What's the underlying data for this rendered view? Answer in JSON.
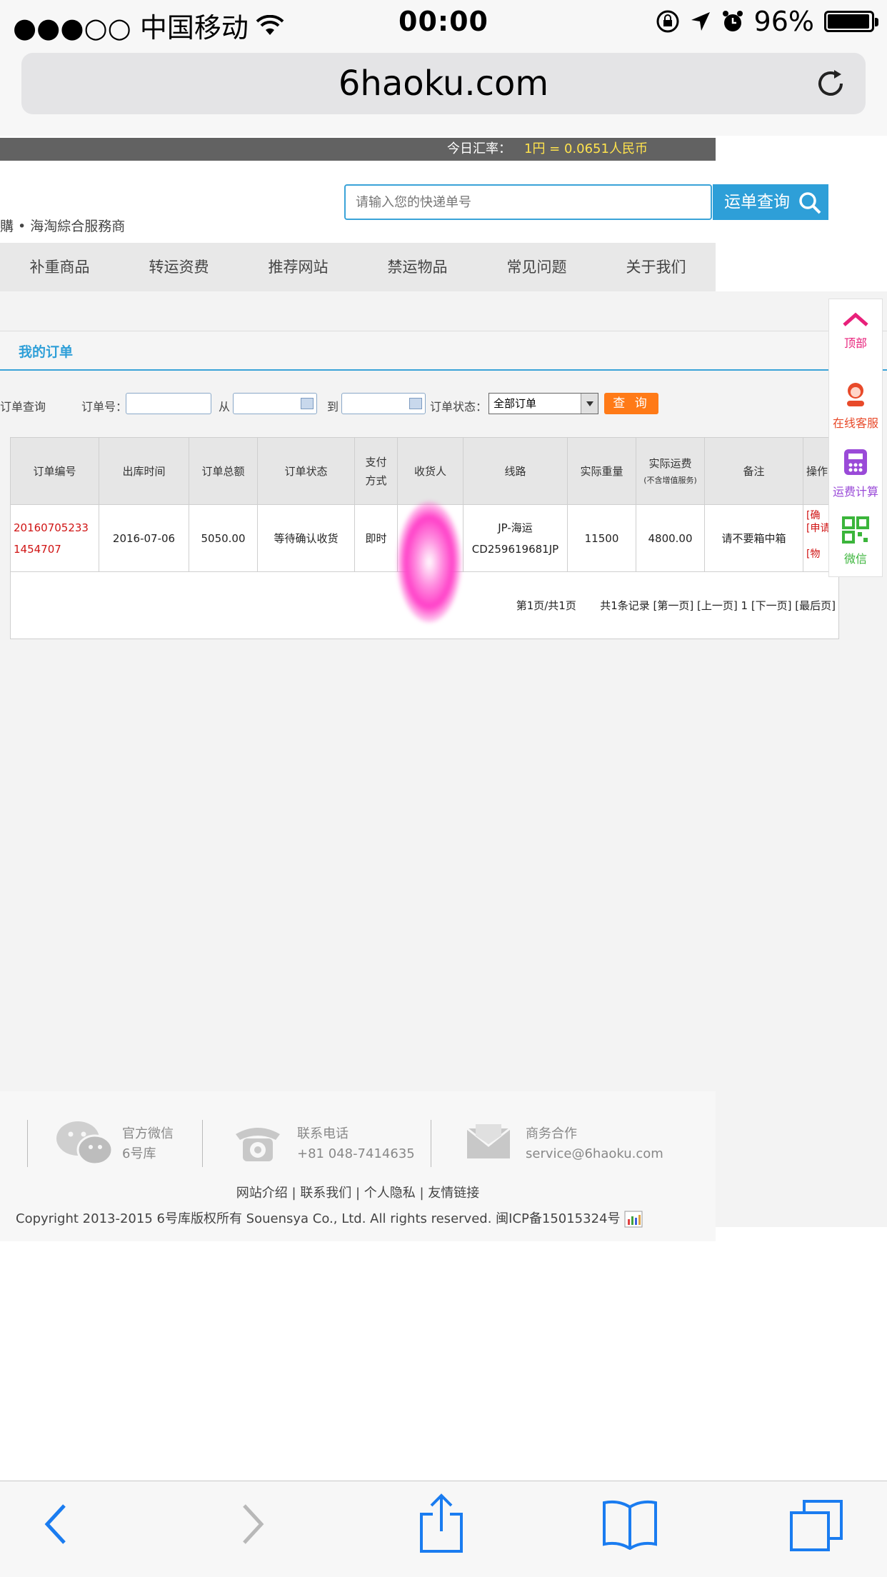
{
  "status_bar": {
    "carrier": "●●●○○ 中国移动",
    "time": "00:00",
    "battery": "96%",
    "battery_level": 0.96
  },
  "browser": {
    "url": "6haoku.com"
  },
  "site": {
    "rate_label": "今日汇率：",
    "rate_value": "1円 = 0.0651人民币",
    "tagline": "購 • 海淘綜合服務商",
    "search_placeholder": "请输入您的快递单号",
    "search_button": "运单查询",
    "nav": [
      "补重商品",
      "转运资费",
      "推荐网站",
      "禁运物品",
      "常见问题",
      "关于我们"
    ]
  },
  "orders_page": {
    "tab_title": "我的订单",
    "filter": {
      "title": "订单查询",
      "order_no_label": "订单号：",
      "from_label": "从",
      "to_label": "到",
      "status_label": "订单状态：",
      "status_value": "全部订单",
      "query_button": "查 询"
    },
    "columns": [
      "订单编号",
      "出库时间",
      "订单总额",
      "订单状态",
      "支付方式",
      "收货人",
      "线路",
      "实际重量",
      "实际运费",
      "备注",
      "操作"
    ],
    "freight_note": "(不含增值服务)",
    "row": {
      "order_no_1": "20160705233",
      "order_no_2": "1454707",
      "date": "2016-07-06",
      "total": "5050.00",
      "status": "等待确认收货",
      "payment": "即时",
      "consignee": "",
      "route_1": "JP-海运",
      "route_2": "CD259619681JP",
      "weight": "11500",
      "freight": "4800.00",
      "remark": "请不要箱中箱",
      "action_1": "[确",
      "action_2": "[申请",
      "action_3": "[物"
    },
    "pager": {
      "page_info": "第1页/共1页",
      "records": "共1条记录 [第一页] [上一页] 1 [下一页] [最后页]"
    }
  },
  "float_panel": {
    "items": [
      {
        "label": "顶部",
        "color": "#e8207a"
      },
      {
        "label": "在线客服",
        "color": "#e84a2a"
      },
      {
        "label": "运费计算",
        "color": "#9a4ad8"
      },
      {
        "label": "微信",
        "color": "#3bb53b"
      }
    ]
  },
  "footer": {
    "wechat_title": "官方微信",
    "wechat_name": "6号库",
    "phone_title": "联系电话",
    "phone_value": "+81 048-7414635",
    "biz_title": "商务合作",
    "biz_email": "service@6haoku.com",
    "links": "网站介绍 | 联系我们 | 个人隐私 | 友情链接",
    "copyright": "Copyright 2013-2015 6号库版权所有 Souensya Co., Ltd. All rights reserved. 闽ICP备15015324号"
  }
}
